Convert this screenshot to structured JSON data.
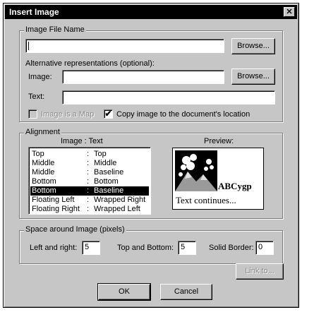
{
  "dialog": {
    "title": "Insert Image",
    "close_glyph": "✕"
  },
  "file_group": {
    "legend": "Image File Name",
    "file_value": "",
    "browse_1": "Browse...",
    "alt_label": "Alternative representations (optional):",
    "image_label": "Image:",
    "image_value": "",
    "browse_2": "Browse...",
    "text_label": "Text:",
    "text_value": "",
    "is_map_label": "Image is a Map",
    "is_map_checked": false,
    "copy_label": "Copy image to the document's location",
    "copy_checked": true,
    "check_glyph": "✔"
  },
  "alignment": {
    "legend": "Alignment",
    "list_header": "Image  :  Text",
    "preview_label": "Preview:",
    "separator": ":",
    "rows": [
      {
        "image": "Top",
        "text": "Top",
        "selected": false
      },
      {
        "image": "Middle",
        "text": "Middle",
        "selected": false
      },
      {
        "image": "Middle",
        "text": "Baseline",
        "selected": false
      },
      {
        "image": "Bottom",
        "text": "Bottom",
        "selected": false
      },
      {
        "image": "Bottom",
        "text": "Baseline",
        "selected": true
      },
      {
        "image": "Floating Left",
        "text": "Wrapped Right",
        "selected": false
      },
      {
        "image": "Floating Right",
        "text": "Wrapped Left",
        "selected": false
      }
    ],
    "preview_inline_text": "ABCygp",
    "preview_continue_text": "Text continues..."
  },
  "spacing": {
    "legend": "Space around Image (pixels)",
    "left_right_label": "Left and right:",
    "left_right_value": "5",
    "top_bottom_label": "Top and Bottom:",
    "top_bottom_value": "5",
    "border_label": "Solid Border:",
    "border_value": "0"
  },
  "buttons": {
    "link_to": "Link to...",
    "ok": "OK",
    "cancel": "Cancel"
  }
}
